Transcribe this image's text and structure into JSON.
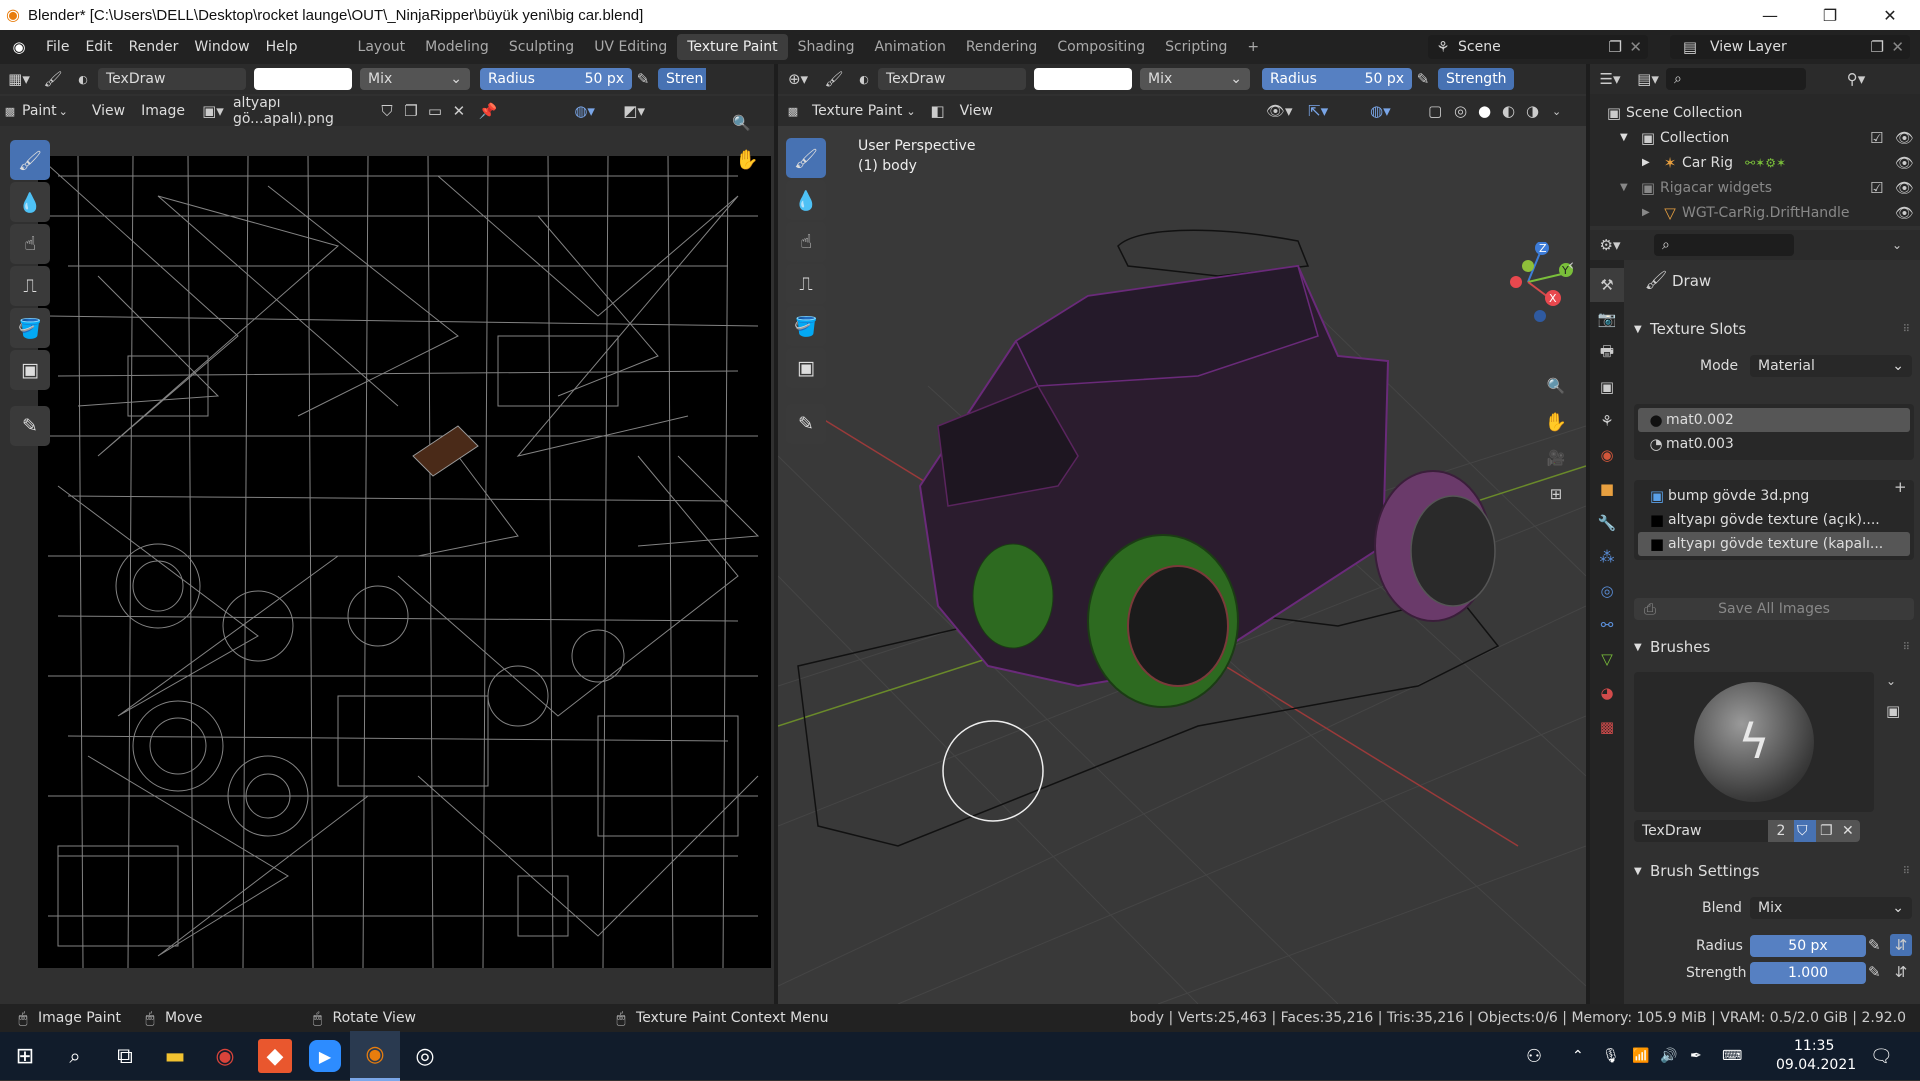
{
  "window": {
    "title": "Blender* [C:\\Users\\DELL\\Desktop\\rocket launge\\OUT\\_NinjaRipper\\büyük yeni\\big car.blend]"
  },
  "menu": {
    "items": [
      "File",
      "Edit",
      "Render",
      "Window",
      "Help"
    ]
  },
  "workspaces": {
    "tabs": [
      "Layout",
      "Modeling",
      "Sculpting",
      "UV Editing",
      "Texture Paint",
      "Shading",
      "Animation",
      "Rendering",
      "Compositing",
      "Scripting"
    ],
    "active": "Texture Paint",
    "add": "+"
  },
  "scene": {
    "label": "Scene",
    "view_layer": "View Layer"
  },
  "image_editor": {
    "brush": "TexDraw",
    "blend": "Mix",
    "radius_label": "Radius",
    "radius_value": "50 px",
    "strength_label": "Stren",
    "mode": "Paint",
    "view": "View",
    "image_menu": "Image",
    "image_name": "altyapı gö...apalı).png"
  },
  "viewport": {
    "brush": "TexDraw",
    "blend": "Mix",
    "radius_label": "Radius",
    "radius_value": "50 px",
    "strength_label": "Strength",
    "mode": "Texture Paint",
    "view": "View",
    "perspective": "User Perspective",
    "object": "(1) body",
    "gizmo": {
      "x": "X",
      "y": "Y",
      "z": "Z"
    }
  },
  "outliner": {
    "scene_collection": "Scene Collection",
    "rows": [
      {
        "label": "Collection"
      },
      {
        "label": "Car Rig"
      },
      {
        "label": "Rigacar widgets"
      },
      {
        "label": "WGT-CarRig.DriftHandle"
      }
    ]
  },
  "properties": {
    "tool_name": "Draw",
    "texture_slots": {
      "title": "Texture Slots",
      "mode_label": "Mode",
      "mode_value": "Material",
      "materials": [
        "mat0.002",
        "mat0.003"
      ],
      "images": [
        "bump gövde 3d.png",
        "altyapı gövde texture (açık)....",
        "altyapı gövde texture (kapalı..."
      ],
      "save_all": "Save All Images"
    },
    "brushes": {
      "title": "Brushes",
      "brush_name": "TexDraw",
      "users": "2"
    },
    "brush_settings": {
      "title": "Brush Settings",
      "blend_label": "Blend",
      "blend_value": "Mix",
      "radius_label": "Radius",
      "radius_value": "50 px",
      "strength_label": "Strength",
      "strength_value": "1.000"
    }
  },
  "statusbar": {
    "left": [
      "Image Paint",
      "Move",
      "Rotate View",
      "Texture Paint Context Menu"
    ],
    "stats": "body | Verts:25,463 | Faces:35,216 | Tris:35,216 | Objects:0/6 | Memory: 105.9 MiB | VRAM: 0.5/2.0 GiB | 2.92.0"
  },
  "taskbar": {
    "time": "11:35",
    "date": "09.04.2021"
  },
  "colors": {
    "accent": "#4772b3",
    "menubar": "#222222",
    "editor_bg": "#303030",
    "viewport_bg": "#393939"
  }
}
